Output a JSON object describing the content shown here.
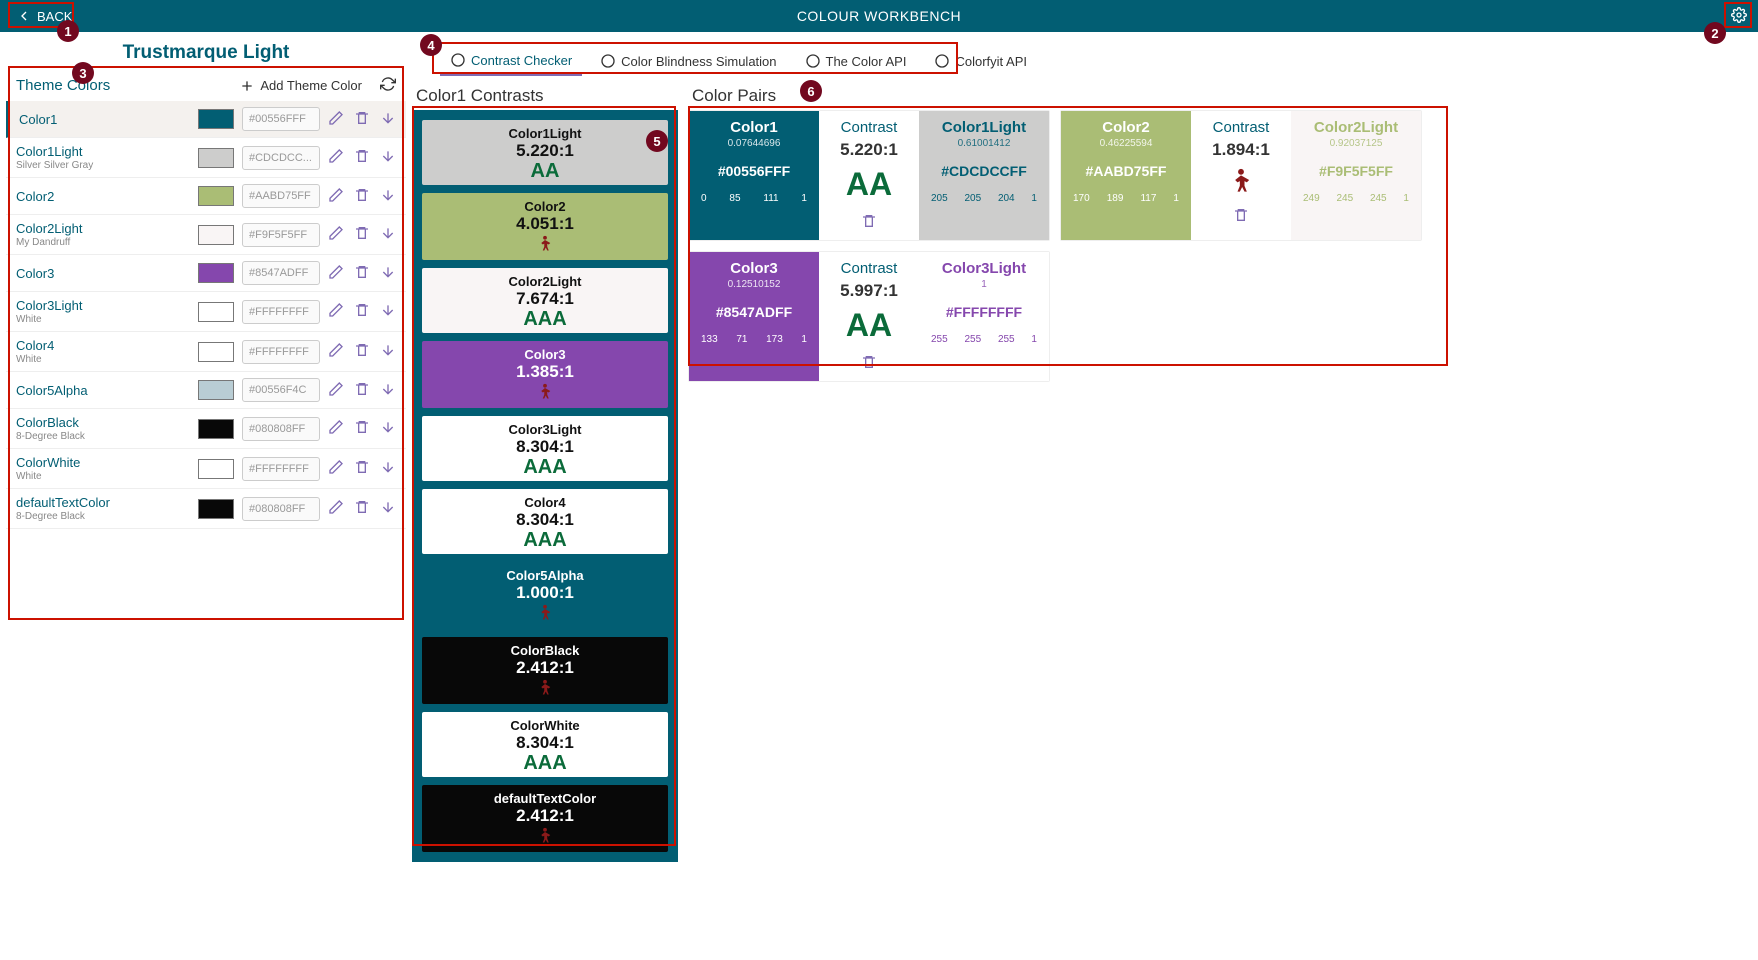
{
  "header": {
    "back": "BACK",
    "title": "COLOUR WORKBENCH"
  },
  "theme": {
    "title": "Trustmarque Light",
    "section_label": "Theme Colors",
    "add_label": "Add Theme Color",
    "colors": [
      {
        "name": "Color1",
        "sub": "",
        "hex": "#00556FFF",
        "swatch": "#025e73",
        "selected": true
      },
      {
        "name": "Color1Light",
        "sub": "Silver Silver Gray",
        "hex": "#CDCDCC...",
        "swatch": "#cdcdcc"
      },
      {
        "name": "Color2",
        "sub": "",
        "hex": "#AABD75FF",
        "swatch": "#aabd75"
      },
      {
        "name": "Color2Light",
        "sub": "My Dandruff",
        "hex": "#F9F5F5FF",
        "swatch": "#f9f5f5"
      },
      {
        "name": "Color3",
        "sub": "",
        "hex": "#8547ADFF",
        "swatch": "#8547ad"
      },
      {
        "name": "Color3Light",
        "sub": "White",
        "hex": "#FFFFFFFF",
        "swatch": "#ffffff"
      },
      {
        "name": "Color4",
        "sub": "White",
        "hex": "#FFFFFFFF",
        "swatch": "#ffffff"
      },
      {
        "name": "Color5Alpha",
        "sub": "",
        "hex": "#00556F4C",
        "swatch": "#b9cdd4"
      },
      {
        "name": "ColorBlack",
        "sub": "8-Degree Black",
        "hex": "#080808FF",
        "swatch": "#080808"
      },
      {
        "name": "ColorWhite",
        "sub": "White",
        "hex": "#FFFFFFFF",
        "swatch": "#ffffff"
      },
      {
        "name": "defaultTextColor",
        "sub": "8-Degree Black",
        "hex": "#080808FF",
        "swatch": "#080808"
      }
    ]
  },
  "tabs": [
    {
      "label": "Contrast Checker",
      "active": true
    },
    {
      "label": "Color Blindness Simulation"
    },
    {
      "label": "The Color API"
    },
    {
      "label": "Colorfyit API"
    }
  ],
  "contrasts": {
    "title": "Color1 Contrasts",
    "items": [
      {
        "name": "Color1Light",
        "ratio": "5.220:1",
        "rating": "AA",
        "bg": "#cdcdcc",
        "fg": "#111"
      },
      {
        "name": "Color2",
        "ratio": "4.051:1",
        "rating": "FAIL",
        "bg": "#aabd75",
        "fg": "#111"
      },
      {
        "name": "Color2Light",
        "ratio": "7.674:1",
        "rating": "AAA",
        "bg": "#f9f5f5",
        "fg": "#111"
      },
      {
        "name": "Color3",
        "ratio": "1.385:1",
        "rating": "FAIL",
        "bg": "#8547ad",
        "fg": "#fff"
      },
      {
        "name": "Color3Light",
        "ratio": "8.304:1",
        "rating": "AAA",
        "bg": "#ffffff",
        "fg": "#111"
      },
      {
        "name": "Color4",
        "ratio": "8.304:1",
        "rating": "AAA",
        "bg": "#ffffff",
        "fg": "#111"
      },
      {
        "name": "Color5Alpha",
        "ratio": "1.000:1",
        "rating": "FAIL",
        "bg": "#025e73",
        "fg": "#fff"
      },
      {
        "name": "ColorBlack",
        "ratio": "2.412:1",
        "rating": "FAIL",
        "bg": "#080808",
        "fg": "#fff"
      },
      {
        "name": "ColorWhite",
        "ratio": "8.304:1",
        "rating": "AAA",
        "bg": "#ffffff",
        "fg": "#111"
      },
      {
        "name": "defaultTextColor",
        "ratio": "2.412:1",
        "rating": "FAIL",
        "bg": "#080808",
        "fg": "#fff"
      }
    ]
  },
  "pairs": {
    "title": "Color Pairs",
    "contrast_label": "Contrast",
    "items": [
      {
        "left_name": "Color1",
        "left_lum": "0.07644696",
        "left_hex": "#00556FFF",
        "left_bg": "#025e73",
        "left_fg": "#fff",
        "rgb": [
          "0",
          "85",
          "111",
          "1"
        ],
        "ratio": "5.220:1",
        "rating": "AA",
        "right_name": "Color1Light",
        "right_lum": "0.61001412",
        "right_hex": "#CDCDCCFF",
        "right_bg": "#cdcdcc",
        "right_fg": "#025e73",
        "rrgb": [
          "205",
          "205",
          "204",
          "1"
        ]
      },
      {
        "left_name": "Color2",
        "left_lum": "0.46225594",
        "left_hex": "#AABD75FF",
        "left_bg": "#aabd75",
        "left_fg": "#fff",
        "rgb": [
          "170",
          "189",
          "117",
          "1"
        ],
        "ratio": "1.894:1",
        "rating": "FAIL",
        "right_name": "Color2Light",
        "right_lum": "0.92037125",
        "right_hex": "#F9F5F5FF",
        "right_bg": "#f9f5f5",
        "right_fg": "#aabd75",
        "rrgb": [
          "249",
          "245",
          "245",
          "1"
        ]
      },
      {
        "left_name": "Color3",
        "left_lum": "0.12510152",
        "left_hex": "#8547ADFF",
        "left_bg": "#8547ad",
        "left_fg": "#fff",
        "rgb": [
          "133",
          "71",
          "173",
          "1"
        ],
        "ratio": "5.997:1",
        "rating": "AA",
        "right_name": "Color3Light",
        "right_lum": "1",
        "right_hex": "#FFFFFFFF",
        "right_bg": "#ffffff",
        "right_fg": "#8547ad",
        "rrgb": [
          "255",
          "255",
          "255",
          "1"
        ]
      }
    ]
  },
  "annotations": [
    "1",
    "2",
    "3",
    "4",
    "5",
    "6"
  ]
}
